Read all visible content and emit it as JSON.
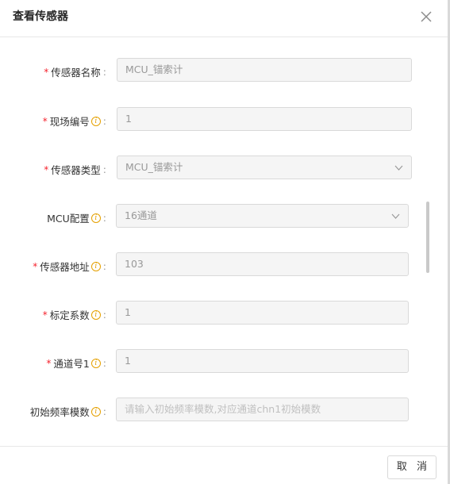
{
  "dialog": {
    "title": "查看传感器",
    "close_icon": "close-icon"
  },
  "fields": {
    "sensor_name": {
      "label": "传感器名称",
      "required": true,
      "value": "MCU_锚索计"
    },
    "site_number": {
      "label": "现场编号",
      "required": true,
      "value": "1"
    },
    "sensor_type": {
      "label": "传感器类型",
      "required": true,
      "value": "MCU_锚索计"
    },
    "mcu_config": {
      "label": "MCU配置",
      "required": false,
      "value": "16通道"
    },
    "sensor_address": {
      "label": "传感器地址",
      "required": true,
      "value": "103"
    },
    "calibration_factor": {
      "label": "标定系数",
      "required": true,
      "value": "1"
    },
    "channel_1": {
      "label": "通道号1",
      "required": true,
      "value": "1"
    },
    "initial_freq_modulus": {
      "label": "初始频率模数",
      "required": false,
      "value": "",
      "placeholder": "请输入初始频率模数,对应通道chn1初始模数"
    }
  },
  "common": {
    "required_mark": "*",
    "info_glyph": "i",
    "colon": ":"
  },
  "footer": {
    "cancel_label": "取 消"
  }
}
